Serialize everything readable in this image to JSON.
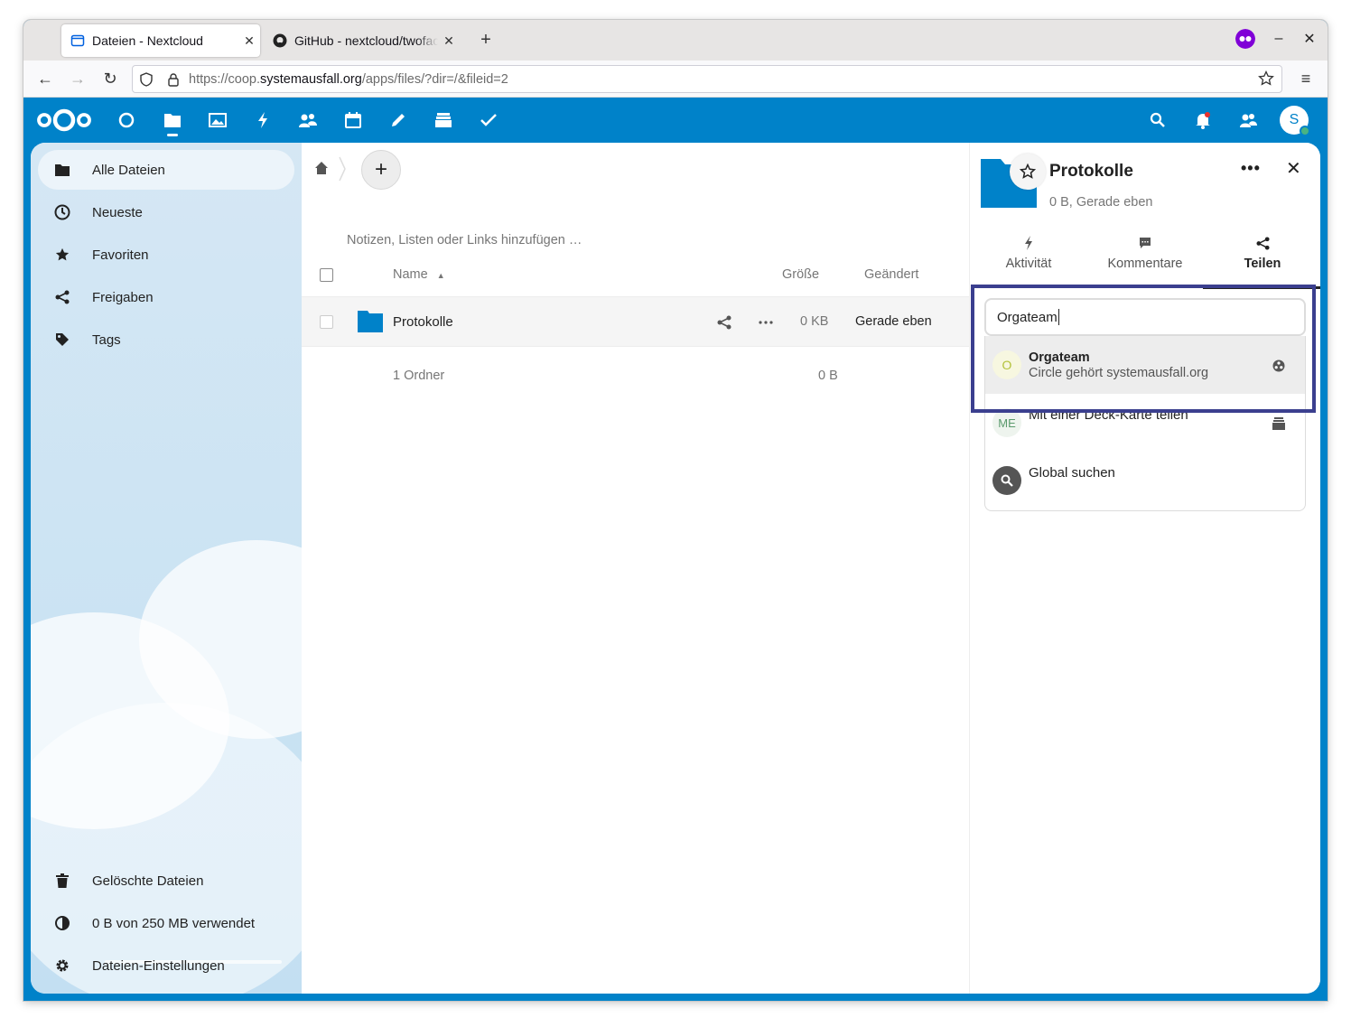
{
  "browser": {
    "tabs": [
      {
        "title": "Dateien - Nextcloud",
        "active": true
      },
      {
        "title": "GitHub - nextcloud/twofactor",
        "active": false
      }
    ],
    "new_tab": "+",
    "url_prefix": "https://coop.",
    "url_domain": "systemausfall.org",
    "url_path": "/apps/files/?dir=/&fileid=2",
    "win_min": "–",
    "win_close": "✕",
    "tab_close": "✕"
  },
  "header": {
    "apps": [
      "dashboard-icon",
      "files-icon",
      "photos-icon",
      "activity-icon",
      "contacts-icon",
      "calendar-icon",
      "notes-icon",
      "deck-icon",
      "tasks-icon"
    ],
    "avatar_letter": "S",
    "accent": "#0082c9"
  },
  "sidebar": {
    "items": [
      {
        "label": "Alle Dateien",
        "icon": "folder-icon"
      },
      {
        "label": "Neueste",
        "icon": "clock-icon"
      },
      {
        "label": "Favoriten",
        "icon": "star-icon"
      },
      {
        "label": "Freigaben",
        "icon": "share-icon"
      },
      {
        "label": "Tags",
        "icon": "tag-icon"
      }
    ],
    "deleted": "Gelöschte Dateien",
    "quota": "0 B von 250 MB verwendet",
    "settings": "Dateien-Einstellungen"
  },
  "main": {
    "add_label": "+",
    "notes_placeholder": "Notizen, Listen oder Links hinzufügen …",
    "columns": {
      "name": "Name",
      "size": "Größe",
      "modified": "Geändert"
    },
    "files": [
      {
        "name": "Protokolle",
        "size": "0 KB",
        "modified": "Gerade eben"
      }
    ],
    "summary": {
      "count": "1 Ordner",
      "size": "0 B"
    }
  },
  "details": {
    "title": "Protokolle",
    "subtitle": "0 B, Gerade eben",
    "more": "•••",
    "close": "✕",
    "tabs": [
      {
        "label": "Aktivität"
      },
      {
        "label": "Kommentare"
      },
      {
        "label": "Teilen"
      }
    ],
    "search_value": "Orgateam",
    "results": [
      {
        "avatar": "O",
        "title": "Orgateam",
        "subtitle": "Circle gehört systemausfall.org"
      },
      {
        "avatar": "ME",
        "title": "Mit einer Deck-Karte teilen"
      },
      {
        "title": "Global suchen"
      }
    ]
  }
}
